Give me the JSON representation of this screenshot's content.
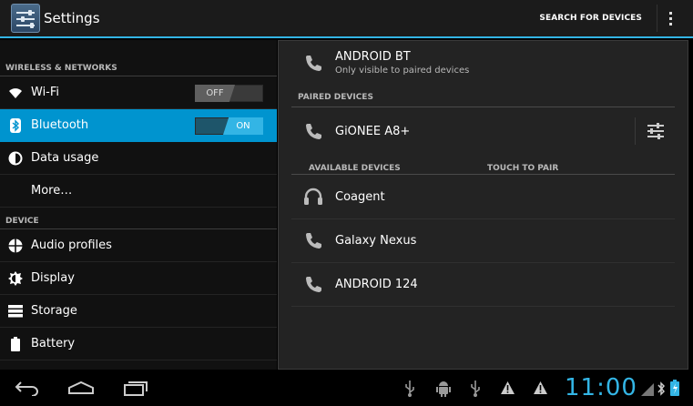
{
  "actionbar": {
    "title": "Settings",
    "search_label": "SEARCH FOR DEVICES",
    "icons": [
      "settings-app-icon",
      "overflow-menu-icon"
    ]
  },
  "sidebar": {
    "sections": [
      {
        "header": "WIRELESS & NETWORKS",
        "items": [
          {
            "label": "Wi-Fi",
            "icon": "wifi-icon",
            "toggle": "OFF"
          },
          {
            "label": "Bluetooth",
            "icon": "bluetooth-icon",
            "toggle": "ON",
            "selected": true
          },
          {
            "label": "Data usage",
            "icon": "data-usage-icon"
          },
          {
            "label": "More…"
          }
        ]
      },
      {
        "header": "DEVICE",
        "items": [
          {
            "label": "Audio profiles",
            "icon": "audio-profiles-icon"
          },
          {
            "label": "Display",
            "icon": "display-icon"
          },
          {
            "label": "Storage",
            "icon": "storage-icon"
          },
          {
            "label": "Battery",
            "icon": "battery-icon"
          }
        ]
      }
    ]
  },
  "bluetooth": {
    "own_device": {
      "name": "ANDROID BT",
      "status": "Only visible to paired devices",
      "icon": "phone-icon"
    },
    "paired_header": "PAIRED DEVICES",
    "paired": [
      {
        "name": "GiONEE A8+",
        "icon": "phone-icon",
        "action_icon": "device-settings-icon"
      }
    ],
    "available_header": "AVAILABLE DEVICES",
    "touch_hint": "TOUCH TO PAIR",
    "available": [
      {
        "name": "Coagent",
        "icon": "headset-icon"
      },
      {
        "name": "Galaxy Nexus",
        "icon": "phone-icon"
      },
      {
        "name": "ANDROID 124",
        "icon": "phone-icon"
      }
    ]
  },
  "systembar": {
    "clock": "11:00",
    "nav_icons": [
      "back-icon",
      "home-icon",
      "recent-apps-icon"
    ],
    "status_icons": [
      "usb-icon",
      "android-debug-icon",
      "usb-icon",
      "warning-icon",
      "warning-icon",
      "signal-icon",
      "bluetooth-status-icon",
      "battery-status-icon"
    ],
    "accent_color": "#33b5e5"
  }
}
